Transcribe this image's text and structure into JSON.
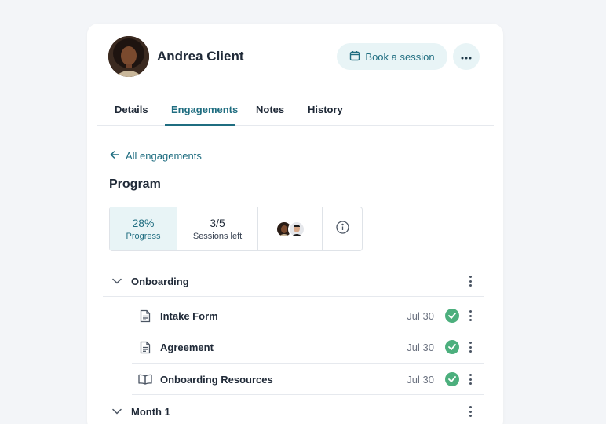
{
  "client": {
    "name": "Andrea Client"
  },
  "header": {
    "book_label": "Book a session"
  },
  "tabs": [
    {
      "label": "Details"
    },
    {
      "label": "Engagements"
    },
    {
      "label": "Notes"
    },
    {
      "label": "History"
    }
  ],
  "active_tab": "Engagements",
  "back_link": "All engagements",
  "section": {
    "title": "Program"
  },
  "stats": {
    "progress_value": "28%",
    "progress_label": "Progress",
    "sessions_value": "3/5",
    "sessions_label": "Sessions left"
  },
  "groups": [
    {
      "label": "Onboarding"
    },
    {
      "label": "Month 1"
    }
  ],
  "items": [
    {
      "label": "Intake Form",
      "date": "Jul 30",
      "icon": "document-icon",
      "status": "complete"
    },
    {
      "label": "Agreement",
      "date": "Jul 30",
      "icon": "document-icon",
      "status": "complete"
    },
    {
      "label": "Onboarding Resources",
      "date": "Jul 30",
      "icon": "book-icon",
      "status": "complete"
    }
  ],
  "colors": {
    "accent": "#1f6d80",
    "accent_bg": "#e8f4f6",
    "success": "#4caf7d"
  }
}
